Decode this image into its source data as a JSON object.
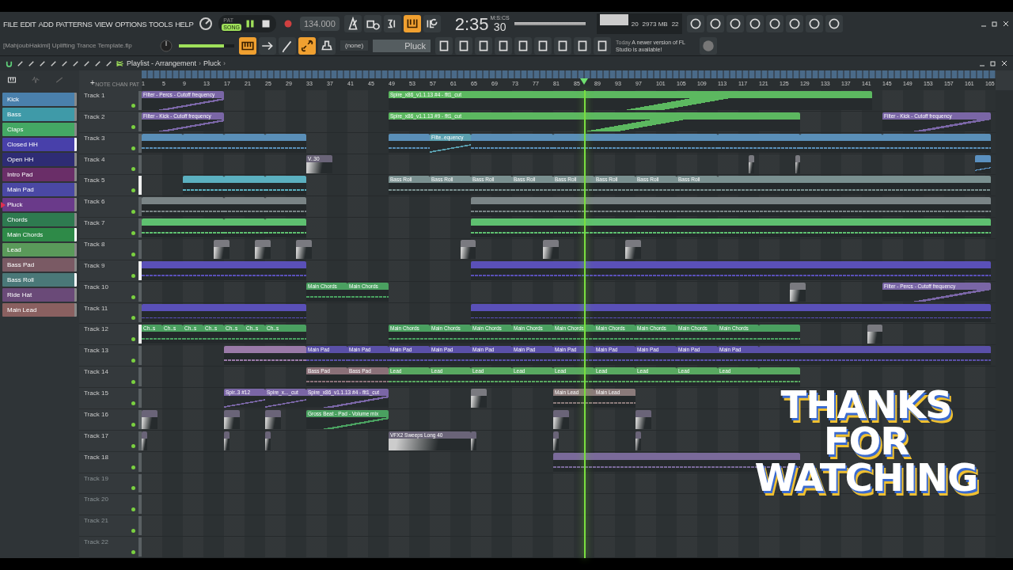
{
  "menu": [
    "FILE",
    "EDIT",
    "ADD",
    "PATTERNS",
    "VIEW",
    "OPTIONS",
    "TOOLS",
    "HELP"
  ],
  "transport": {
    "modes": [
      {
        "label": "PAT",
        "selected": false
      },
      {
        "label": "SONG",
        "selected": true
      }
    ],
    "playing": true,
    "recording": false,
    "tempo": "134.000",
    "time_main": "2:35",
    "time_small": "30",
    "time_format": "M:S:CS"
  },
  "master_volume": {
    "level": 0.82
  },
  "row1_toggles": [
    {
      "kind": "metronome",
      "on": false
    },
    {
      "kind": "wait",
      "on": false
    },
    {
      "kind": "countdown",
      "on": false
    },
    {
      "kind": "step",
      "on": true
    },
    {
      "kind": "loop",
      "on": false
    }
  ],
  "monitor": {
    "cpu": "20",
    "memory": "2973 MB",
    "polyphony": "22"
  },
  "project_name": "[MahjoubHakimi] Uplifting Trance Template.flp",
  "row2_toggles": [
    {
      "kind": "keyboard",
      "on": true
    },
    {
      "kind": "arrow",
      "on": false
    },
    {
      "kind": "pen",
      "on": false
    },
    {
      "kind": "link",
      "on": true
    },
    {
      "kind": "stamp",
      "on": false
    }
  ],
  "midi_target": "(none)",
  "pattern": "Pluck",
  "news": {
    "when": "Today",
    "text": "A newer version of FL Studio is available!"
  },
  "playlist": {
    "title": "Playlist - Arrangement",
    "separator": "›",
    "pattern": "Pluck",
    "trail": "›",
    "header_tabs": [
      "NOTE",
      "CHAN",
      "PAT"
    ],
    "add": "+"
  },
  "channels": [
    {
      "name": "Kick",
      "color": "#4a80ac",
      "current": false,
      "selected": false
    },
    {
      "name": "Bass",
      "color": "#3f9aa8",
      "current": false,
      "selected": false
    },
    {
      "name": "Claps",
      "color": "#44a864",
      "current": false,
      "selected": false
    },
    {
      "name": "Closed HH",
      "color": "#4840aa",
      "current": false,
      "selected": true
    },
    {
      "name": "Open HH",
      "color": "#2e2c74",
      "current": false,
      "selected": false
    },
    {
      "name": "Intro Pad",
      "color": "#6a2e68",
      "current": false,
      "selected": false
    },
    {
      "name": "Main Pad",
      "color": "#4a48a4",
      "current": false,
      "selected": false
    },
    {
      "name": "Pluck",
      "color": "#6a3a8a",
      "current": true,
      "selected": false
    },
    {
      "name": "Chords",
      "color": "#2e7a50",
      "current": false,
      "selected": false
    },
    {
      "name": "Main Chords",
      "color": "#2e8a48",
      "current": false,
      "selected": true
    },
    {
      "name": "Lead",
      "color": "#5a9a5a",
      "current": false,
      "selected": false
    },
    {
      "name": "Bass Pad",
      "color": "#7a5a64",
      "current": false,
      "selected": false
    },
    {
      "name": "Bass Roll",
      "color": "#4a7878",
      "current": false,
      "selected": true
    },
    {
      "name": "Ride Hat",
      "color": "#6a4a78",
      "current": false,
      "selected": false
    },
    {
      "name": "Main Lead",
      "color": "#8a6060",
      "current": false,
      "selected": false
    }
  ],
  "ruler": [
    "1",
    "5",
    "9",
    "13",
    "17",
    "21",
    "25",
    "29",
    "33",
    "37",
    "41",
    "45",
    "49",
    "53",
    "57",
    "61",
    "65",
    "69",
    "73",
    "77",
    "81",
    "85",
    "89",
    "93",
    "97",
    "101",
    "105",
    "109",
    "113",
    "117",
    "121",
    "125",
    "129",
    "133",
    "137",
    "141",
    "145",
    "149",
    "153",
    "157",
    "161",
    "165"
  ],
  "tracks": [
    {
      "name": "Track 1",
      "selected": false,
      "clips": [
        {
          "kind": "automation",
          "label": "Filter - Percs - Cutoff frequency",
          "color": "#7a66a6"
        },
        {
          "kind": "automation",
          "label": "Spire_x86_v1.1.13 #4 - flt1_cut",
          "color": "#5cb860"
        }
      ]
    },
    {
      "name": "Track 2",
      "selected": false,
      "clips": [
        {
          "kind": "automation",
          "label": "Filter - Kick - Cutoff frequency",
          "color": "#7a66a6"
        },
        {
          "kind": "automation",
          "label": "Spire_x86_v1.1.13 #9 - flt1_cut",
          "color": "#5cb860"
        },
        {
          "kind": "automation",
          "label": "Filter - Kick - Cutoff frequency",
          "color": "#7a66a6"
        }
      ]
    },
    {
      "name": "Track 3",
      "selected": false,
      "clips": [
        {
          "kind": "pattern",
          "color": "#5a8fb8"
        },
        {
          "kind": "pattern",
          "color": "#5a8fb8"
        },
        {
          "kind": "pattern",
          "color": "#5a8fb8"
        },
        {
          "kind": "pattern",
          "color": "#5a8fb8"
        },
        {
          "kind": "pattern",
          "color": "#5a8fb8"
        },
        {
          "kind": "automation",
          "label": "Filte..equency",
          "color": "#5aa0b0"
        },
        {
          "kind": "pattern",
          "color": "#5a8fb8"
        },
        {
          "kind": "pattern",
          "color": "#5a8fb8"
        },
        {
          "kind": "pattern",
          "color": "#5a8fb8"
        },
        {
          "kind": "pattern",
          "color": "#5a8fb8"
        },
        {
          "kind": "pattern",
          "color": "#5a8fb8"
        }
      ]
    },
    {
      "name": "Track 4",
      "selected": false,
      "clips": [
        {
          "kind": "audio",
          "label": "V..30",
          "color": "#6a6478"
        },
        {
          "kind": "audio",
          "color": "#7a7a80"
        },
        {
          "kind": "audio",
          "color": "#7a7a80"
        },
        {
          "kind": "automation",
          "color": "#5a90c0"
        }
      ]
    },
    {
      "name": "Track 5",
      "selected": true,
      "clips": [
        {
          "kind": "pattern",
          "color": "#5bb0c0"
        },
        {
          "kind": "pattern",
          "color": "#5bb0c0"
        },
        {
          "kind": "pattern",
          "color": "#5bb0c0"
        },
        {
          "kind": "pattern",
          "label": "Bass Roll",
          "color": "#7a9090"
        },
        {
          "kind": "pattern",
          "label": "Bass Roll",
          "color": "#7a9090"
        },
        {
          "kind": "pattern",
          "label": "Bass Roll",
          "color": "#7a9090"
        },
        {
          "kind": "pattern",
          "label": "Bass Roll",
          "color": "#7a9090"
        },
        {
          "kind": "pattern",
          "label": "Bass Roll",
          "color": "#7a9090"
        },
        {
          "kind": "pattern",
          "label": "Bass Roll",
          "color": "#7a9090"
        },
        {
          "kind": "pattern",
          "label": "Bass Roll",
          "color": "#7a9090"
        },
        {
          "kind": "pattern",
          "label": "Bass Roll",
          "color": "#7a9090"
        },
        {
          "kind": "pattern",
          "color": "#7a9090"
        }
      ]
    },
    {
      "name": "Track 6",
      "selected": false,
      "clips": [
        {
          "kind": "pattern",
          "color": "#7a8486"
        },
        {
          "kind": "pattern",
          "color": "#7a8486"
        },
        {
          "kind": "pattern",
          "color": "#7a8486"
        },
        {
          "kind": "pattern",
          "color": "#7a8486"
        }
      ]
    },
    {
      "name": "Track 7",
      "selected": false,
      "clips": [
        {
          "kind": "pattern",
          "color": "#5ec070"
        },
        {
          "kind": "pattern",
          "color": "#5ec070"
        },
        {
          "kind": "pattern",
          "color": "#5ec070"
        },
        {
          "kind": "pattern",
          "color": "#5ec070"
        }
      ]
    },
    {
      "name": "Track 8",
      "selected": false,
      "clips": [
        {
          "kind": "audio",
          "color": "#7a7a80"
        },
        {
          "kind": "audio",
          "color": "#7a7a80"
        },
        {
          "kind": "audio",
          "color": "#7a7a80"
        },
        {
          "kind": "audio",
          "color": "#7a7a80"
        },
        {
          "kind": "audio",
          "color": "#7a7a80"
        },
        {
          "kind": "audio",
          "color": "#7a7a80"
        }
      ]
    },
    {
      "name": "Track 9",
      "selected": true,
      "clips": [
        {
          "kind": "pattern",
          "color": "#5a50b8"
        },
        {
          "kind": "pattern",
          "color": "#5a50b8"
        }
      ]
    },
    {
      "name": "Track 10",
      "selected": false,
      "clips": [
        {
          "kind": "pattern",
          "label": "Main Chords",
          "color": "#4aa060"
        },
        {
          "kind": "pattern",
          "label": "Main Chords",
          "color": "#4aa060"
        },
        {
          "kind": "audio",
          "color": "#7a7a80"
        },
        {
          "kind": "automation",
          "label": "Filter - Percs - Cutoff frequency",
          "color": "#7a66a6"
        }
      ]
    },
    {
      "name": "Track 11",
      "selected": false,
      "clips": [
        {
          "kind": "pattern",
          "color": "#5a50b8"
        },
        {
          "kind": "pattern",
          "color": "#5a50b8"
        }
      ]
    },
    {
      "name": "Track 12",
      "selected": true,
      "clips": [
        {
          "kind": "pattern",
          "label": "Ch..s",
          "color": "#4aa060"
        },
        {
          "kind": "pattern",
          "label": "Ch..s",
          "color": "#4aa060"
        },
        {
          "kind": "pattern",
          "label": "Ch..s",
          "color": "#4aa060"
        },
        {
          "kind": "pattern",
          "label": "Ch..s",
          "color": "#4aa060"
        },
        {
          "kind": "pattern",
          "label": "Ch..s",
          "color": "#4aa060"
        },
        {
          "kind": "pattern",
          "label": "Ch..s",
          "color": "#4aa060"
        },
        {
          "kind": "pattern",
          "label": "Ch..s",
          "color": "#4aa060"
        },
        {
          "kind": "pattern",
          "label": "Main Chords",
          "color": "#4aa060"
        },
        {
          "kind": "pattern",
          "label": "Main Chords",
          "color": "#4aa060"
        },
        {
          "kind": "pattern",
          "label": "Main Chords",
          "color": "#4aa060"
        },
        {
          "kind": "pattern",
          "label": "Main Chords",
          "color": "#4aa060"
        },
        {
          "kind": "pattern",
          "label": "Main Chords",
          "color": "#4aa060"
        },
        {
          "kind": "pattern",
          "label": "Main Chords",
          "color": "#4aa060"
        },
        {
          "kind": "pattern",
          "label": "Main Chords",
          "color": "#4aa060"
        },
        {
          "kind": "pattern",
          "label": "Main Chords",
          "color": "#4aa060"
        },
        {
          "kind": "pattern",
          "label": "Main Chords",
          "color": "#4aa060"
        },
        {
          "kind": "pattern",
          "color": "#4aa060"
        },
        {
          "kind": "audio",
          "color": "#7a7a80"
        }
      ]
    },
    {
      "name": "Track 13",
      "selected": false,
      "clips": [
        {
          "kind": "pattern",
          "color": "#9a7aa8"
        },
        {
          "kind": "pattern",
          "label": "Main Pad",
          "color": "#5a50a8"
        },
        {
          "kind": "pattern",
          "label": "Main Pad",
          "color": "#5a50a8"
        },
        {
          "kind": "pattern",
          "label": "Main Pad",
          "color": "#5a50a8"
        },
        {
          "kind": "pattern",
          "label": "Main Pad",
          "color": "#5a50a8"
        },
        {
          "kind": "pattern",
          "label": "Main Pad",
          "color": "#5a50a8"
        },
        {
          "kind": "pattern",
          "label": "Main Pad",
          "color": "#5a50a8"
        },
        {
          "kind": "pattern",
          "label": "Main Pad",
          "color": "#5a50a8"
        },
        {
          "kind": "pattern",
          "label": "Main Pad",
          "color": "#5a50a8"
        },
        {
          "kind": "pattern",
          "label": "Main Pad",
          "color": "#5a50a8"
        },
        {
          "kind": "pattern",
          "label": "Main Pad",
          "color": "#5a50a8"
        },
        {
          "kind": "pattern",
          "label": "Main Pad",
          "color": "#5a50a8"
        },
        {
          "kind": "pattern",
          "color": "#5a50a8"
        }
      ]
    },
    {
      "name": "Track 14",
      "selected": false,
      "clips": [
        {
          "kind": "pattern",
          "label": "Bass Pad",
          "color": "#8a7078"
        },
        {
          "kind": "pattern",
          "label": "Bass Pad",
          "color": "#8a7078"
        },
        {
          "kind": "pattern",
          "label": "Lead",
          "color": "#58a860"
        },
        {
          "kind": "pattern",
          "label": "Lead",
          "color": "#58a860"
        },
        {
          "kind": "pattern",
          "label": "Lead",
          "color": "#58a860"
        },
        {
          "kind": "pattern",
          "label": "Lead",
          "color": "#58a860"
        },
        {
          "kind": "pattern",
          "label": "Lead",
          "color": "#58a860"
        },
        {
          "kind": "pattern",
          "label": "Lead",
          "color": "#58a860"
        },
        {
          "kind": "pattern",
          "label": "Lead",
          "color": "#58a860"
        },
        {
          "kind": "pattern",
          "label": "Lead",
          "color": "#58a860"
        },
        {
          "kind": "pattern",
          "label": "Lead",
          "color": "#58a860"
        },
        {
          "kind": "pattern",
          "color": "#58a860"
        }
      ]
    },
    {
      "name": "Track 15",
      "selected": false,
      "clips": [
        {
          "kind": "automation",
          "label": "Spir..3 #12",
          "color": "#7a66a6"
        },
        {
          "kind": "automation",
          "label": "Spire_x..._cut",
          "color": "#7a66a6"
        },
        {
          "kind": "automation",
          "label": "Spire_x86_v1.1.13 #4 - flt1_cut",
          "color": "#7a66a6"
        },
        {
          "kind": "audio",
          "color": "#7a7a80"
        },
        {
          "kind": "pattern",
          "label": "Main Lead",
          "color": "#8a7a7a"
        },
        {
          "kind": "pattern",
          "label": "Main Lead",
          "color": "#8a7a7a"
        }
      ]
    },
    {
      "name": "Track 16",
      "selected": false,
      "clips": [
        {
          "kind": "audio",
          "color": "#6a6478"
        },
        {
          "kind": "audio",
          "color": "#6a6478"
        },
        {
          "kind": "audio",
          "color": "#6a6478"
        },
        {
          "kind": "automation",
          "label": "Gross Beat - Pad - Volume mix",
          "color": "#4aa060"
        },
        {
          "kind": "audio",
          "color": "#6a6478"
        },
        {
          "kind": "audio",
          "color": "#6a6478"
        }
      ]
    },
    {
      "name": "Track 17",
      "selected": false,
      "clips": [
        {
          "kind": "audio",
          "color": "#6a6478"
        },
        {
          "kind": "audio",
          "color": "#6a6478"
        },
        {
          "kind": "audio",
          "color": "#6a6478"
        },
        {
          "kind": "audio",
          "label": "VFX2 Sweeps Long 40",
          "color": "#6a6478"
        },
        {
          "kind": "audio",
          "color": "#6a6478"
        },
        {
          "kind": "audio",
          "color": "#6a6478"
        },
        {
          "kind": "audio",
          "color": "#6a6478"
        }
      ]
    },
    {
      "name": "Track 18",
      "selected": false,
      "clips": [
        {
          "kind": "pattern",
          "color": "#7a6a9a"
        }
      ]
    },
    {
      "name": "Track 19",
      "selected": false
    },
    {
      "name": "Track 20",
      "selected": false
    },
    {
      "name": "Track 21",
      "selected": false
    },
    {
      "name": "Track 22",
      "selected": false
    }
  ],
  "end_card": [
    "THANKS",
    "FOR",
    "WATCHING"
  ]
}
